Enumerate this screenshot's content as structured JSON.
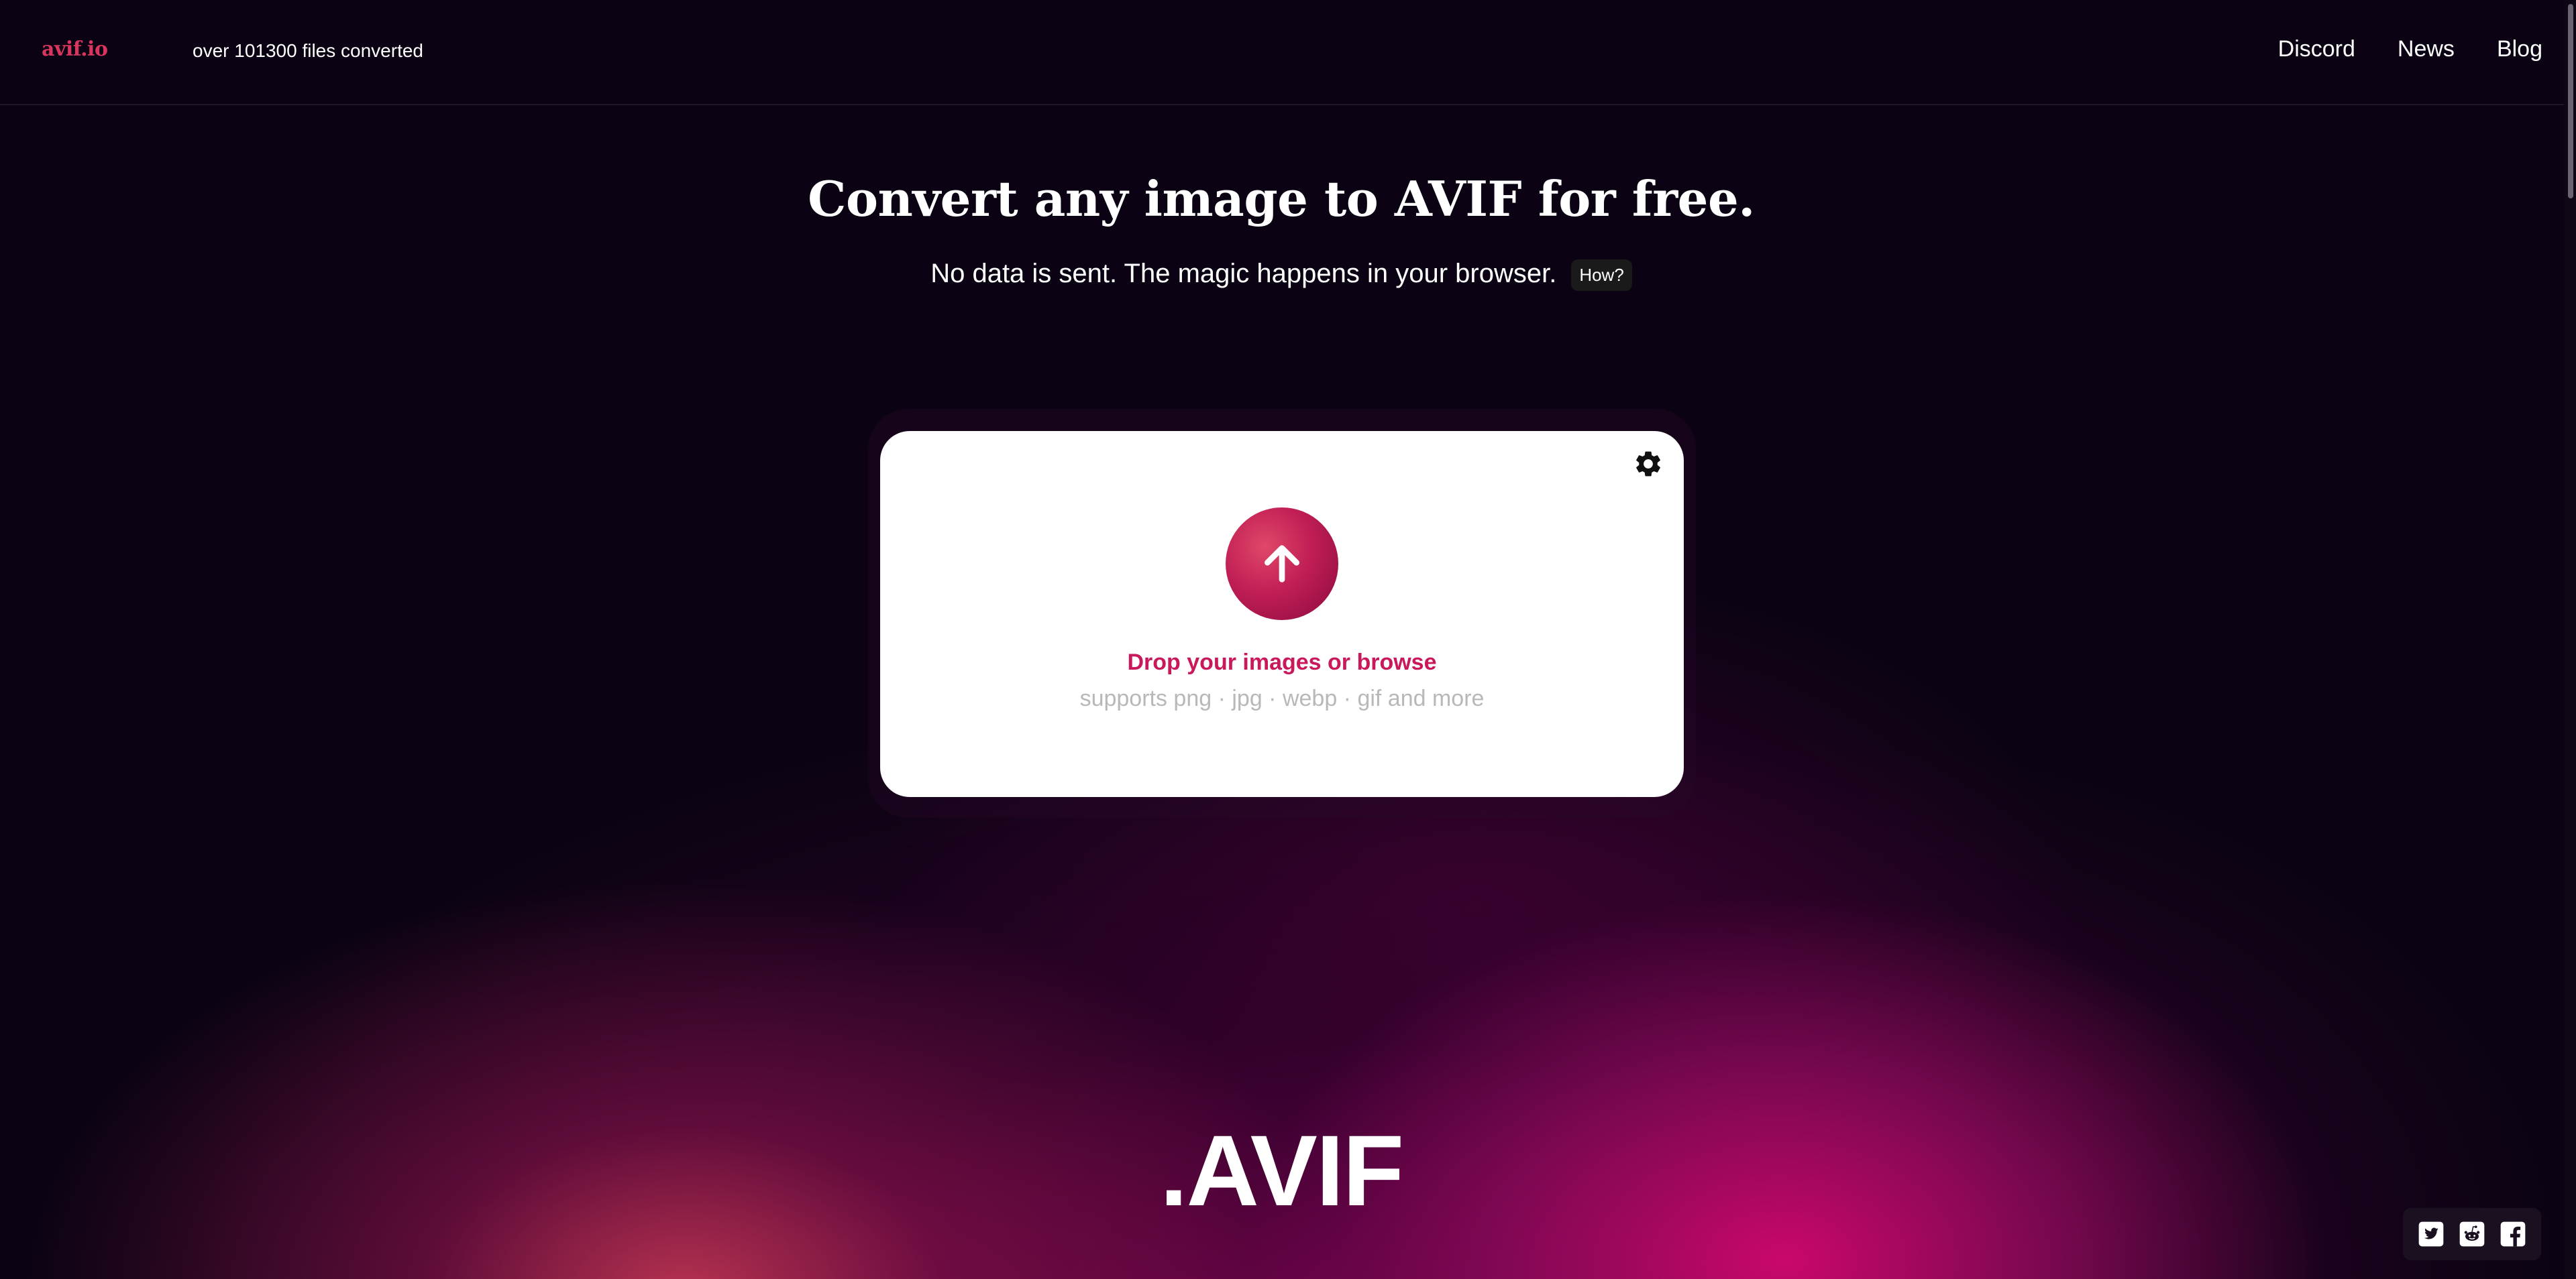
{
  "header": {
    "logo": "avif.io",
    "counter": "over 101300 files converted",
    "nav": [
      "Discord",
      "News",
      "Blog"
    ]
  },
  "hero": {
    "title": "Convert any image to AVIF for free.",
    "subtitle": "No data is sent. The magic happens in your browser.",
    "how_label": "How?"
  },
  "dropzone": {
    "title": "Drop your images or browse",
    "supports": "supports png · jpg · webp · gif and more"
  },
  "big_label": ".AVIF",
  "social": [
    "twitter-icon",
    "reddit-icon",
    "facebook-icon"
  ],
  "colors": {
    "background": "#0b0313",
    "accent": "#c9185c",
    "logo": "#d8365f"
  }
}
